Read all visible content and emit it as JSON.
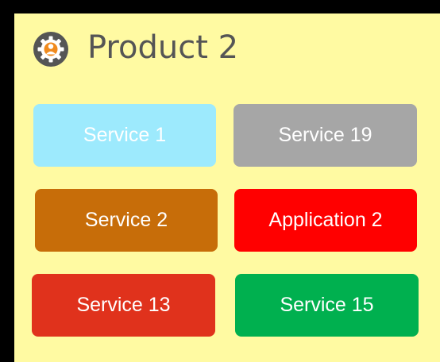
{
  "product": {
    "title": "Product 2",
    "icon": "gear-person-icon"
  },
  "services": [
    {
      "label": "Service 1",
      "color": "#9deafd"
    },
    {
      "label": "Service 19",
      "color": "#a6a6a6"
    },
    {
      "label": "Service 2",
      "color": "#c76d09"
    },
    {
      "label": "Application 2",
      "color": "#ff0000"
    },
    {
      "label": "Service 13",
      "color": "#e0321c"
    },
    {
      "label": "Service 15",
      "color": "#00b04f"
    }
  ],
  "colors": {
    "background": "#000000",
    "panel": "#fffaa2",
    "title_text": "#555555",
    "icon_ring": "#555555",
    "icon_center": "#f08a1d"
  }
}
